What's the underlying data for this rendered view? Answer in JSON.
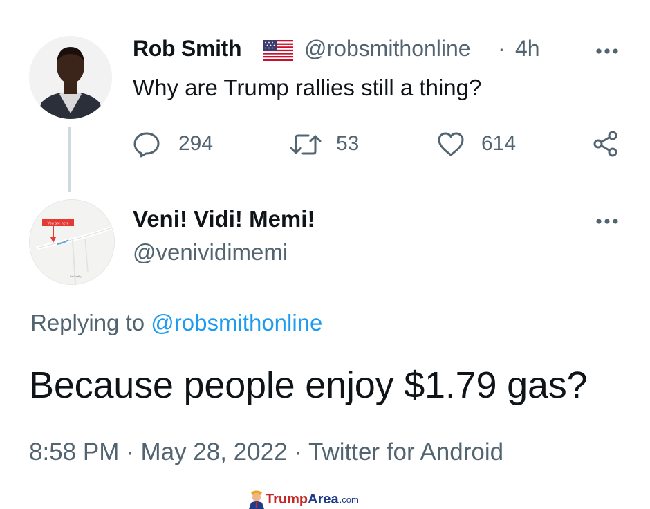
{
  "parent_tweet": {
    "author_name": "Rob Smith",
    "author_handle": "@robsmithonline",
    "separator": "·",
    "time_ago": "4h",
    "text": "Why are Trump rallies still a thing?",
    "flag_icon": "us-flag-icon",
    "actions": {
      "replies": "294",
      "retweets": "53",
      "likes": "614"
    }
  },
  "reply_tweet": {
    "author_name": "Veni! Vidi! Memi!",
    "author_handle": "@venividimemi",
    "replying_prefix": "Replying to",
    "replying_to": "@robsmithonline",
    "text": "Because people enjoy $1.79 gas?",
    "meta": "8:58 PM · May 28, 2022 · Twitter for Android",
    "avatar_map_label": "You are here",
    "avatar_map_place": "Le Grafty"
  },
  "watermark": {
    "part1": "Trump",
    "part2": "Area",
    "part3": ".com"
  },
  "colors": {
    "text": "#0f1419",
    "secondary": "#536471",
    "link": "#1d9bf0",
    "thread_line": "#cfd9de"
  }
}
